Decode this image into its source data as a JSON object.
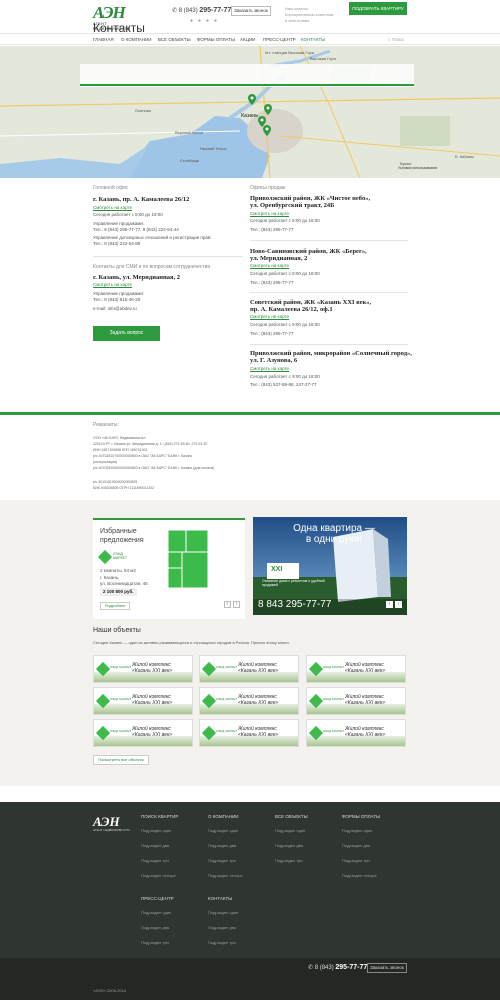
{
  "header": {
    "logo_text": "АЭН",
    "logo_sub": "АГЕНТ НЕДВИЖИМОСТИ",
    "phone_prefix": "8 (843)",
    "phone_main": "295-77-77",
    "callback_label": "Заказать звонок",
    "top_link_1": "Наш каталог",
    "top_link_2": "Корпоративным клиентам",
    "top_link_3": "и агентствам",
    "cta_label": "ПОДОБРАТЬ КВАРТИРУ"
  },
  "nav": {
    "items": [
      "Главная",
      "О компании",
      "Все объекты",
      "Формы оплаты",
      "Акции",
      "Пресс-центр",
      "Контакты"
    ],
    "search_placeholder": "Поиск"
  },
  "map": {
    "title": "Контакты",
    "labels": [
      "Высокая Гора",
      "пгт. станция Высокая Гора",
      "Верхний Услон",
      "Казань",
      "Осиново",
      "Столбище",
      "Б. Кабаны",
      "Нижний Услон",
      "Куюки"
    ],
    "attribution": "Условия использования"
  },
  "head_office": {
    "title": "Головной офис",
    "address": "г. Казань, пр. А. Камалеева 26/12",
    "map_link": "Смотреть на карте",
    "hours": "Сегодня работает с 8:00 до 19:00",
    "line1": "Управление продажами:",
    "line2": "Тел.: 8 (843) 295-77-77, 8 (843) 222-54-44",
    "line3": "Управление договорных отношений и регистрации прав:",
    "line4": "Тел.: 8 (843) 222-54-89"
  },
  "smi": {
    "title": "Контакты для СМИ и по вопросам сотрудничества",
    "address": "г. Казань, ул. Меридианная, 2",
    "map_link": "Смотреть на карте",
    "line1": "Управление продажами:",
    "line2": "Тел.: 8 (843) 515-46-20",
    "line3": "e-mail: info@abdev.ru",
    "btn": "Задать вопрос"
  },
  "sales_offices": {
    "title": "Офисы продаж",
    "offices": [
      {
        "address_1": "Приволжский район, ЖК «Чистое небо»,",
        "address_2": "ул. Оренбургский тракт, 24Б",
        "map": "Смотреть на карте",
        "hours": "Сегодня работает с 9:00 до 18:00",
        "phone": "Тел.: (843) 295-77-77"
      },
      {
        "address_1": "Ново-Савиновский район, ЖК «Берег»,",
        "address_2": "ул. Меридианная, 2",
        "map": "Смотреть на карте",
        "hours": "Сегодня работает с 9:00 до 18:00",
        "phone": "Тел.: (843) 295-77-77"
      },
      {
        "address_1": "Советский район, ЖК «Казань XXI век»,",
        "address_2": "пр. А. Камалеева 26/12, оф.1",
        "map": "Смотреть на карте",
        "hours": "Сегодня работает с 9:00 до 18:00",
        "phone": "Тел.: (843) 295-77-77"
      },
      {
        "address_1": "Приволжский район, микрорайон «Солнечный город»,",
        "address_2": "ул. Г. Азунова, 6",
        "map": "Смотреть на карте",
        "hours": "Сегодня работает с 9:00 до 18:00",
        "phone": "Тел.: (843) 537-88-88, 247-27-77"
      }
    ]
  },
  "requisites": {
    "title": "Реквизиты:",
    "lines": [
      "ООО «АК БАРС Недвижимость»",
      "420124 РТ, г. Казань ул. Меридианная д. 1 / (843) 272-59-60, 272-51-87",
      "ИНН 1657100898 КПП 165701001",
      "р/с 40702810700000000600 в ОАО \"АК БАРС\" БАНК г. Казань",
      "(консультация)",
      "р/с 40702810900000000600 в ОАО \"АК БАРС\" БАНК г. Казань (для оплаты)",
      "к/с 30101810000000000805",
      "БИК 049205805 ОГРН 1111690011202"
    ]
  },
  "promo": {
    "title_1": "Избранные",
    "title_2": "предложения",
    "brand": "ЛЭНД МАРКЕТ",
    "rooms": "2 комнаты, 54 м2",
    "city": "г. Казань,",
    "street": "ул. Восемнадцатая, 46",
    "price": "2 100 800 руб.",
    "pick_btn": "Подробнее",
    "banner_line1": "Одна квартира —",
    "banner_line2": "в одни руки!",
    "banner_brand": "XXI",
    "banner_note": "Описание дома с ремонтом и удобной продажей",
    "banner_phone": "8 843 295-77-77"
  },
  "objects": {
    "title": "Наши объекты",
    "subtitle": "Сегодня Казань — один из активно развивающихся и строящихся городов в России. Причин этому много.",
    "tile_brand": "ЛЭНД МАРКЕТ",
    "tile_line1": "Жилой комплекс",
    "tile_line2": "«Казань XXI век»",
    "all_btn": "Посмотреть все объекты"
  },
  "footer": {
    "columns": [
      {
        "title": "Поиск квартир",
        "links": [
          "Подраздел один",
          "Подраздел два",
          "Подраздел три",
          "Подраздел четыре"
        ]
      },
      {
        "title": "О компании",
        "links": [
          "Подраздел один",
          "Подраздел два",
          "Подраздел три",
          "Подраздел четыре"
        ]
      },
      {
        "title": "Все объекты",
        "links": [
          "Подраздел один",
          "Подраздел два",
          "Подраздел три"
        ]
      },
      {
        "title": "Формы оплаты",
        "links": [
          "Подраздел один",
          "Подраздел два",
          "Подраздел три",
          "Подраздел четыре"
        ]
      },
      {
        "title": "Пресс-центр",
        "links": [
          "Подраздел один",
          "Подраздел два",
          "Подраздел три"
        ]
      },
      {
        "title": "Контакты",
        "links": [
          "Подраздел один",
          "Подраздел два",
          "Подраздел три"
        ]
      }
    ],
    "phone_prefix": "8 (843)",
    "phone_main": "295-77-77",
    "callback_label": "Заказать звонок",
    "copyright": "«АЭН» 2006-2014"
  },
  "colors": {
    "accent": "#2e9a3e",
    "footer_bg": "#2f3530",
    "grey_bg": "#f3f2ef"
  }
}
